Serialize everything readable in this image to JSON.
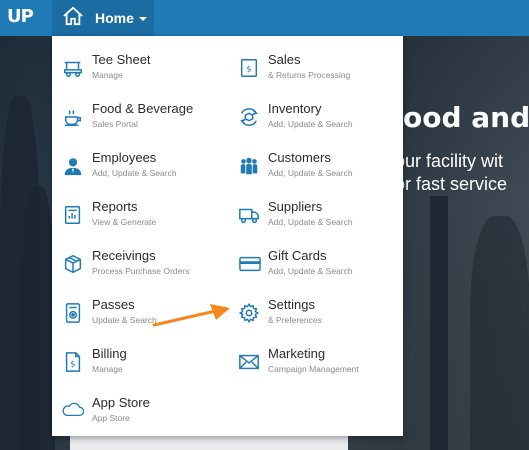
{
  "app": {
    "logo_text": "UP"
  },
  "topbar": {
    "home_label": "Home"
  },
  "hero": {
    "line1": "ood and I",
    "line2a": "our facility wit",
    "line2b": "or fast service"
  },
  "menu": {
    "left": [
      {
        "title": "Tee Sheet",
        "subtitle": "Manage"
      },
      {
        "title": "Food & Beverage",
        "subtitle": "Sales Portal"
      },
      {
        "title": "Employees",
        "subtitle": "Add, Update & Search"
      },
      {
        "title": "Reports",
        "subtitle": "View & Generate"
      },
      {
        "title": "Receivings",
        "subtitle": "Process Purchase Orders"
      },
      {
        "title": "Passes",
        "subtitle": "Update & Search"
      },
      {
        "title": "Billing",
        "subtitle": "Manage"
      },
      {
        "title": "App Store",
        "subtitle": "App Store"
      }
    ],
    "right": [
      {
        "title": "Sales",
        "subtitle": "& Returns Processing"
      },
      {
        "title": "Inventory",
        "subtitle": "Add, Update & Search"
      },
      {
        "title": "Customers",
        "subtitle": "Add, Update & Search"
      },
      {
        "title": "Suppliers",
        "subtitle": "Add, Update & Search"
      },
      {
        "title": "Gift Cards",
        "subtitle": "Add, Update & Search"
      },
      {
        "title": "Settings",
        "subtitle": "& Preferences"
      },
      {
        "title": "Marketing",
        "subtitle": "Campaign Management"
      }
    ]
  },
  "colors": {
    "topbar": "#1f7ab6",
    "icon": "#1f7ab6",
    "arrow": "#f5871f"
  },
  "icons": [
    "home-icon",
    "golf-cart-icon",
    "coffee-cup-icon",
    "employee-icon",
    "report-icon",
    "box-icon",
    "pass-icon",
    "billing-icon",
    "cloud-icon",
    "sales-icon",
    "inventory-icon",
    "customers-icon",
    "truck-icon",
    "gift-card-icon",
    "gear-icon",
    "envelope-icon"
  ]
}
